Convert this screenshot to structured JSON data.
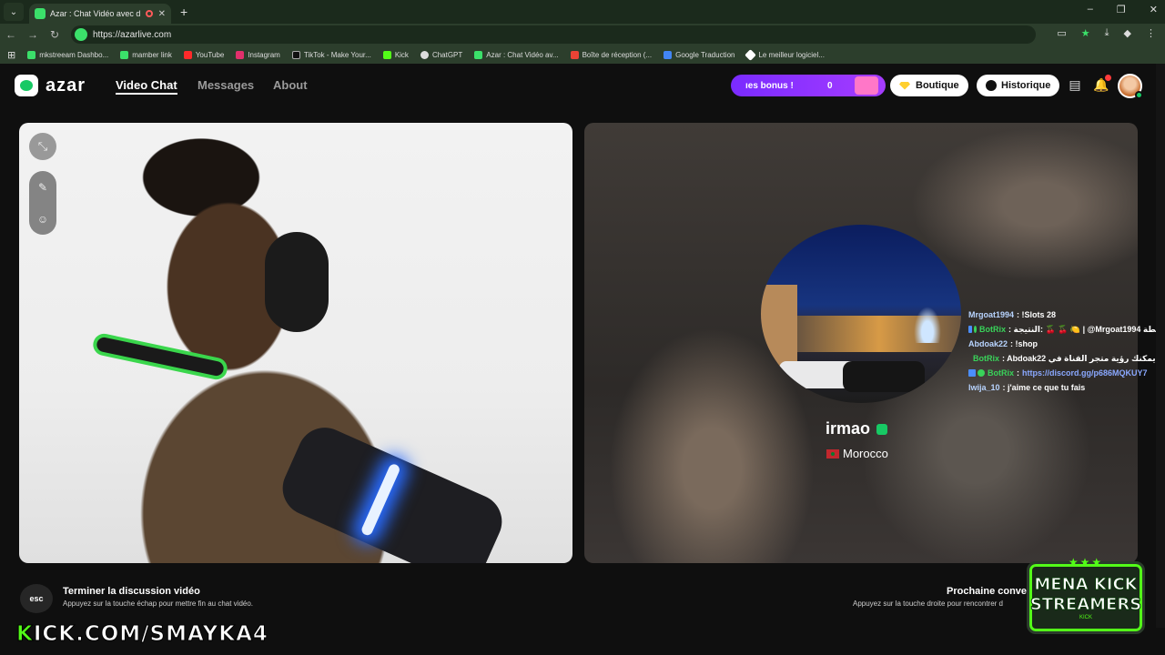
{
  "browser": {
    "tab_title": "Azar : Chat Vidéo avec de n",
    "url": "https://azarlive.com",
    "bookmarks": [
      "mkstreeam Dashbo...",
      "mamber link",
      "YouTube",
      "Instagram",
      "TikTok - Make Your...",
      "Kick",
      "ChatGPT",
      "Azar : Chat Vidéo av...",
      "Boîte de réception (...",
      "Google Traduction",
      "Le meilleur logiciel..."
    ]
  },
  "nav": {
    "logo": "azar",
    "links": [
      "Video Chat",
      "Messages",
      "About"
    ],
    "bonus_label": "ıes bonus !",
    "bonus_count": "0",
    "shop": "Boutique",
    "history": "Historique"
  },
  "partner": {
    "username": "irmao",
    "country": "Morocco"
  },
  "chat": [
    {
      "user": "Mrgoat1994",
      "msg": ": !Slots 28",
      "bot": false
    },
    {
      "user": "BotRix",
      "msg": ": النتيجة: 🍒 🍒 🍋 | @Mrgoat1994 لقطة",
      "bot": true
    },
    {
      "user": "Abdoak22",
      "msg": ": !shop",
      "bot": false
    },
    {
      "user": "BotRix",
      "msg": ": Abdoak22 يمكنك رؤية متجر القناة في",
      "link": "https",
      "bot": true
    },
    {
      "user": "BotRix",
      "msg": ":",
      "link": "https://discord.gg/p686MQKUY7",
      "bot": true
    },
    {
      "user": "lwija_10",
      "msg": ": j'aime ce que tu fais",
      "bot": false
    }
  ],
  "bottom": {
    "esc": "esc",
    "end_title": "Terminer la discussion vidéo",
    "end_sub": "Appuyez sur la touche échap pour mettre fin au chat vidéo.",
    "next_title": "Prochaine conve",
    "next_sub": "Appuyez sur la touche droite pour rencontrer d"
  },
  "overlay": {
    "kick_k": "K",
    "kick_rest": "ICK.COM/SMAYKA4",
    "mena_l1": "MENA KICK",
    "mena_l2": "STREAMERS",
    "mena_tag": "KICK"
  },
  "colors": {
    "accent": "#17c964",
    "bonus": "#8a33ff",
    "kick": "#53fc18"
  }
}
